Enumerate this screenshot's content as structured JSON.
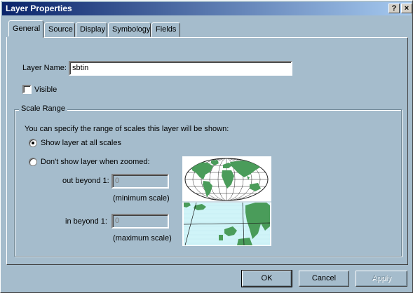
{
  "window": {
    "title": "Layer Properties",
    "help_button": "?",
    "close_button": "×"
  },
  "tabs": [
    {
      "label": "General",
      "active": true
    },
    {
      "label": "Source",
      "active": false
    },
    {
      "label": "Display",
      "active": false
    },
    {
      "label": "Symbology",
      "active": false
    },
    {
      "label": "Fields",
      "active": false
    }
  ],
  "general": {
    "layer_name_label": "Layer Name:",
    "layer_name_value": "sbtin",
    "visible_label": "Visible",
    "visible_checked": false
  },
  "scale_range": {
    "group_title": "Scale Range",
    "description": "You can specify the range of scales this layer will be shown:",
    "option_all_label": "Show layer at all scales",
    "option_zoomed_label": "Don't show layer when zoomed:",
    "selected_option": "all",
    "out_beyond_label": "out beyond  1:",
    "out_beyond_value": "0",
    "out_beyond_caption": "(minimum scale)",
    "in_beyond_label": "in beyond  1:",
    "in_beyond_value": "0",
    "in_beyond_caption": "(maximum scale)"
  },
  "buttons": {
    "ok": "OK",
    "cancel": "Cancel",
    "apply": "Apply"
  },
  "colors": {
    "dialog_bg": "#a5bccc",
    "titlebar_start": "#0a246a",
    "land_green": "#4a9c5a",
    "ocean_cyan": "#d0f4f8"
  }
}
